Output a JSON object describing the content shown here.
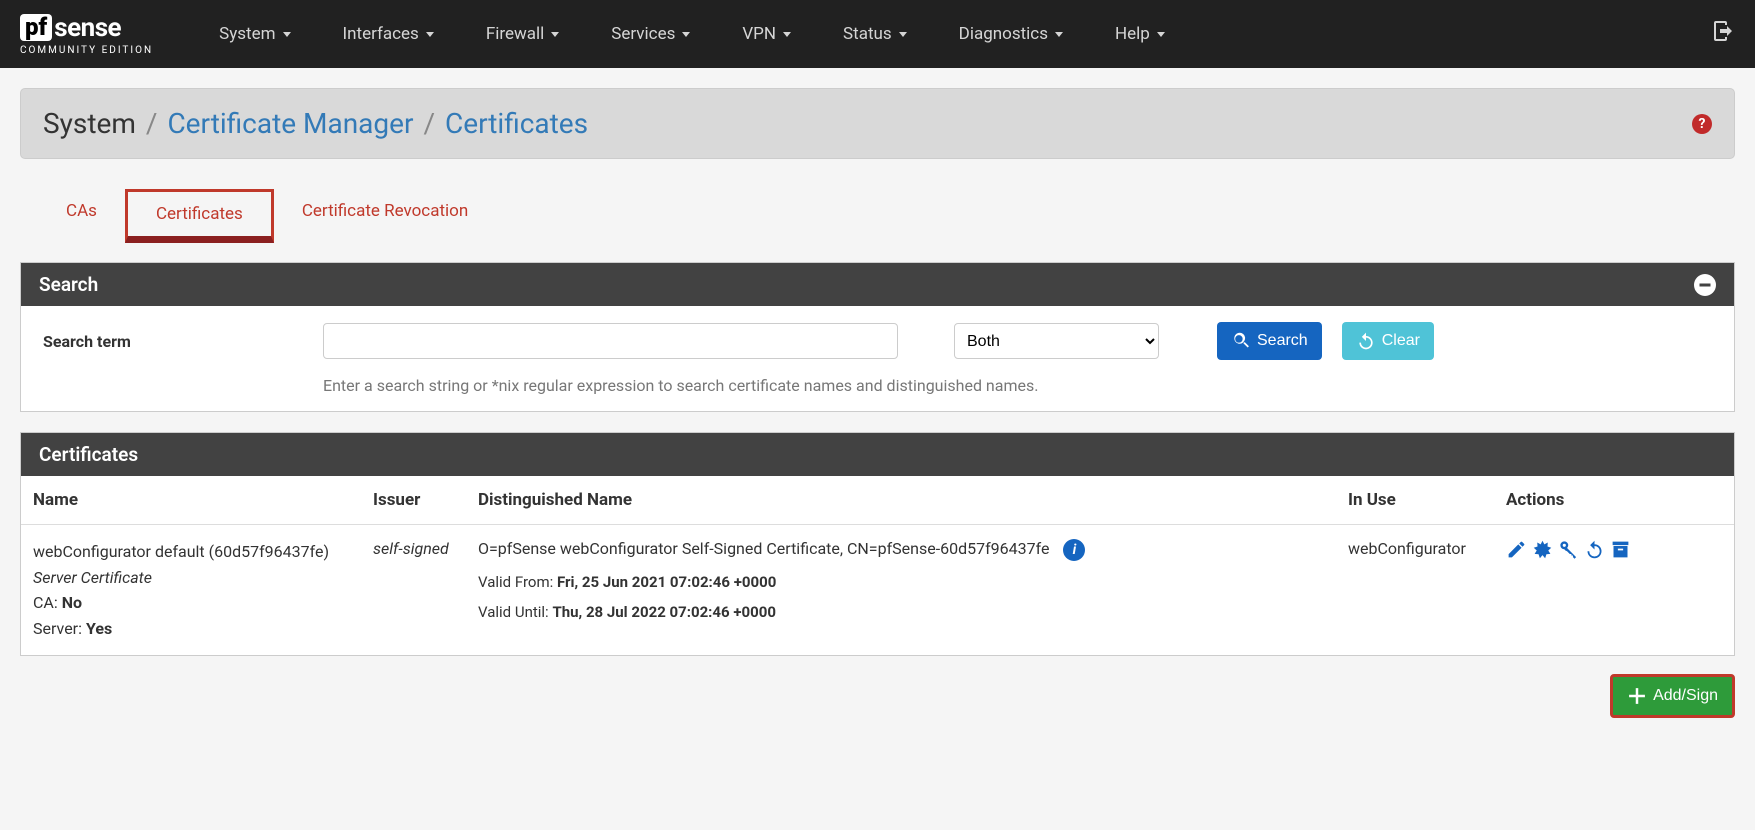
{
  "logo": {
    "pf": "pf",
    "sense": "sense",
    "edition": "COMMUNITY EDITION"
  },
  "nav": [
    "System",
    "Interfaces",
    "Firewall",
    "Services",
    "VPN",
    "Status",
    "Diagnostics",
    "Help"
  ],
  "breadcrumb": {
    "root": "System",
    "mid": "Certificate Manager",
    "leaf": "Certificates"
  },
  "tabs": [
    "CAs",
    "Certificates",
    "Certificate Revocation"
  ],
  "active_tab": 1,
  "search_panel": {
    "title": "Search",
    "label": "Search term",
    "select_value": "Both",
    "search_btn": "Search",
    "clear_btn": "Clear",
    "help": "Enter a search string or *nix regular expression to search certificate names and distinguished names."
  },
  "cert_panel": {
    "title": "Certificates",
    "headers": {
      "name": "Name",
      "issuer": "Issuer",
      "dn": "Distinguished Name",
      "inuse": "In Use",
      "actions": "Actions"
    },
    "rows": [
      {
        "name": "webConfigurator default (60d57f96437fe)",
        "type": "Server Certificate",
        "ca_label": "CA:",
        "ca_value": "No",
        "server_label": "Server:",
        "server_value": "Yes",
        "issuer": "self-signed",
        "dn": "O=pfSense webConfigurator Self-Signed Certificate, CN=pfSense-60d57f96437fe",
        "valid_from_label": "Valid From:",
        "valid_from": "Fri, 25 Jun 2021 07:02:46 +0000",
        "valid_until_label": "Valid Until:",
        "valid_until": "Thu, 28 Jul 2022 07:02:46 +0000",
        "inuse": "webConfigurator"
      }
    ]
  },
  "add_btn": "Add/Sign"
}
